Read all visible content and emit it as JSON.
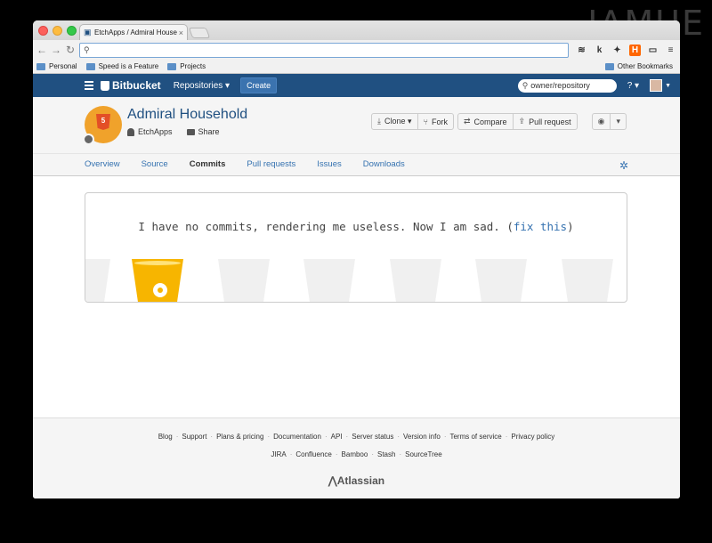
{
  "watermark": "IAMUE",
  "browser": {
    "tab_title": "EtchApps / Admiral Household",
    "tab_close": "×",
    "url": "",
    "bookmarks": [
      "Personal",
      "Speed is a Feature",
      "Projects"
    ],
    "other_bookmarks": "Other Bookmarks",
    "extensions": [
      "buffer-icon",
      "klout-icon",
      "twitter-icon",
      "h-icon",
      "cast-icon"
    ]
  },
  "header": {
    "logo": "Bitbucket",
    "repositories": "Repositories ▾",
    "create": "Create",
    "search_placeholder": "owner/repository",
    "help": "? ▾"
  },
  "repo": {
    "name": "Admiral Household",
    "owner": "EtchApps",
    "share": "Share",
    "actions": {
      "clone": "Clone ▾",
      "fork": "Fork",
      "compare": "Compare",
      "pull_request": "Pull request"
    },
    "html5_badge": "5"
  },
  "tabs": [
    "Overview",
    "Source",
    "Commits",
    "Pull requests",
    "Issues",
    "Downloads"
  ],
  "active_tab": "Commits",
  "empty": {
    "message_before": "I have no commits, rendering me useless. Now I am sad. (",
    "fix_link": "fix this",
    "message_after": ")"
  },
  "footer": {
    "row1": [
      "Blog",
      "Support",
      "Plans & pricing",
      "Documentation",
      "API",
      "Server status",
      "Version info",
      "Terms of service",
      "Privacy policy"
    ],
    "row2": [
      "JIRA",
      "Confluence",
      "Bamboo",
      "Stash",
      "SourceTree"
    ],
    "brand": "Atlassian"
  },
  "colors": {
    "brand_blue": "#205081",
    "link_blue": "#3572b0",
    "bucket_gold": "#f7b500"
  }
}
